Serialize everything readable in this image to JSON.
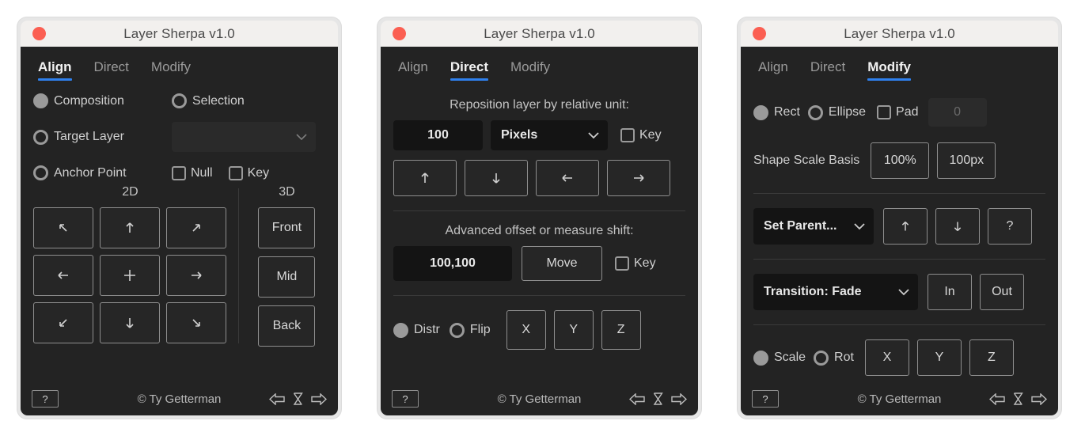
{
  "window": {
    "title": "Layer Sherpa v1.0",
    "close_dot_color": "#fb5f52",
    "accent_color": "#2f80ed"
  },
  "tabs": [
    {
      "label": "Align"
    },
    {
      "label": "Direct"
    },
    {
      "label": "Modify"
    }
  ],
  "footer": {
    "help_label": "?",
    "copyright": "© Ty Getterman",
    "icons": [
      "arrow-left-outline",
      "hourglass",
      "arrow-right-outline"
    ]
  },
  "panel_align": {
    "active_tab": "Align",
    "radio_composition": "Composition",
    "radio_selection": "Selection",
    "radio_target_layer": "Target Layer",
    "target_layer_select_value": "",
    "radio_anchor_point": "Anchor Point",
    "check_null": "Null",
    "check_key": "Key",
    "caption_2d": "2D",
    "caption_3d": "3D",
    "grid_2d": [
      "arrow-up-left",
      "arrow-up",
      "arrow-up-right",
      "arrow-left",
      "plus",
      "arrow-right",
      "arrow-down-left",
      "arrow-down",
      "arrow-down-right"
    ],
    "buttons_3d": [
      "Front",
      "Mid",
      "Back"
    ]
  },
  "panel_direct": {
    "active_tab": "Direct",
    "caption_reposition": "Reposition layer by relative unit:",
    "amount_value": "100",
    "unit_value": "Pixels",
    "key_label_1": "Key",
    "nudge_buttons": [
      "arrow-up",
      "arrow-down",
      "arrow-left",
      "arrow-right"
    ],
    "caption_advanced": "Advanced offset or measure shift:",
    "offset_value": "100,100",
    "move_label": "Move",
    "key_label_2": "Key",
    "radio_distr": "Distr",
    "radio_flip": "Flip",
    "axis_buttons": [
      "X",
      "Y",
      "Z"
    ]
  },
  "panel_modify": {
    "active_tab": "Modify",
    "radio_rect": "Rect",
    "radio_ellipse": "Ellipse",
    "check_pad": "Pad",
    "pad_value": "0",
    "label_shape_scale_basis": "Shape Scale Basis",
    "scale_percent": "100%",
    "scale_pixels": "100px",
    "parent_select": "Set Parent...",
    "parent_buttons": [
      "arrow-up",
      "arrow-down",
      "?"
    ],
    "transition_select": "Transition: Fade",
    "transition_buttons": [
      "In",
      "Out"
    ],
    "radio_scale": "Scale",
    "radio_rot": "Rot",
    "axis_buttons": [
      "X",
      "Y",
      "Z"
    ]
  }
}
